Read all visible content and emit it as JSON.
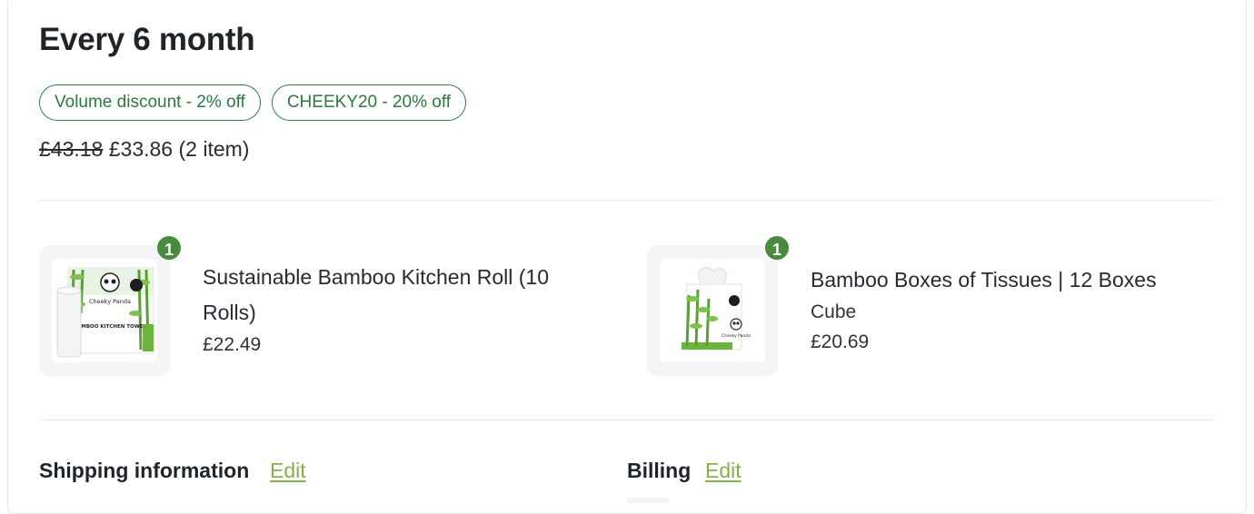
{
  "subscription": {
    "title": "Every 6 month",
    "discounts": [
      {
        "label": "Volume discount - 2% off"
      },
      {
        "label": "CHEEKY20 - 20% off"
      }
    ],
    "original_price": "£43.18",
    "price_summary": "£33.86 (2 item)"
  },
  "items": [
    {
      "name_line1": "Sustainable Bamboo Kitchen Roll (10",
      "name_line2": "Rolls)",
      "variant": "",
      "price": "£22.49",
      "quantity": "1",
      "image_text": {
        "brand": "Cheeky Panda",
        "product": "BAMBOO KITCHEN TOWEL"
      }
    },
    {
      "name_line1": "Bamboo Boxes of Tissues | 12 Boxes",
      "name_line2": "",
      "variant": "Cube",
      "price": "£20.69",
      "quantity": "1",
      "image_text": {
        "brand": "Cheeky Panda"
      }
    }
  ],
  "shipping": {
    "label": "Shipping information",
    "edit_label": "Edit"
  },
  "billing": {
    "label": "Billing",
    "edit_label": "Edit"
  },
  "colors": {
    "accent_green": "#2b7841",
    "badge_green": "#4a8a3f",
    "link_green": "#86b04a"
  }
}
